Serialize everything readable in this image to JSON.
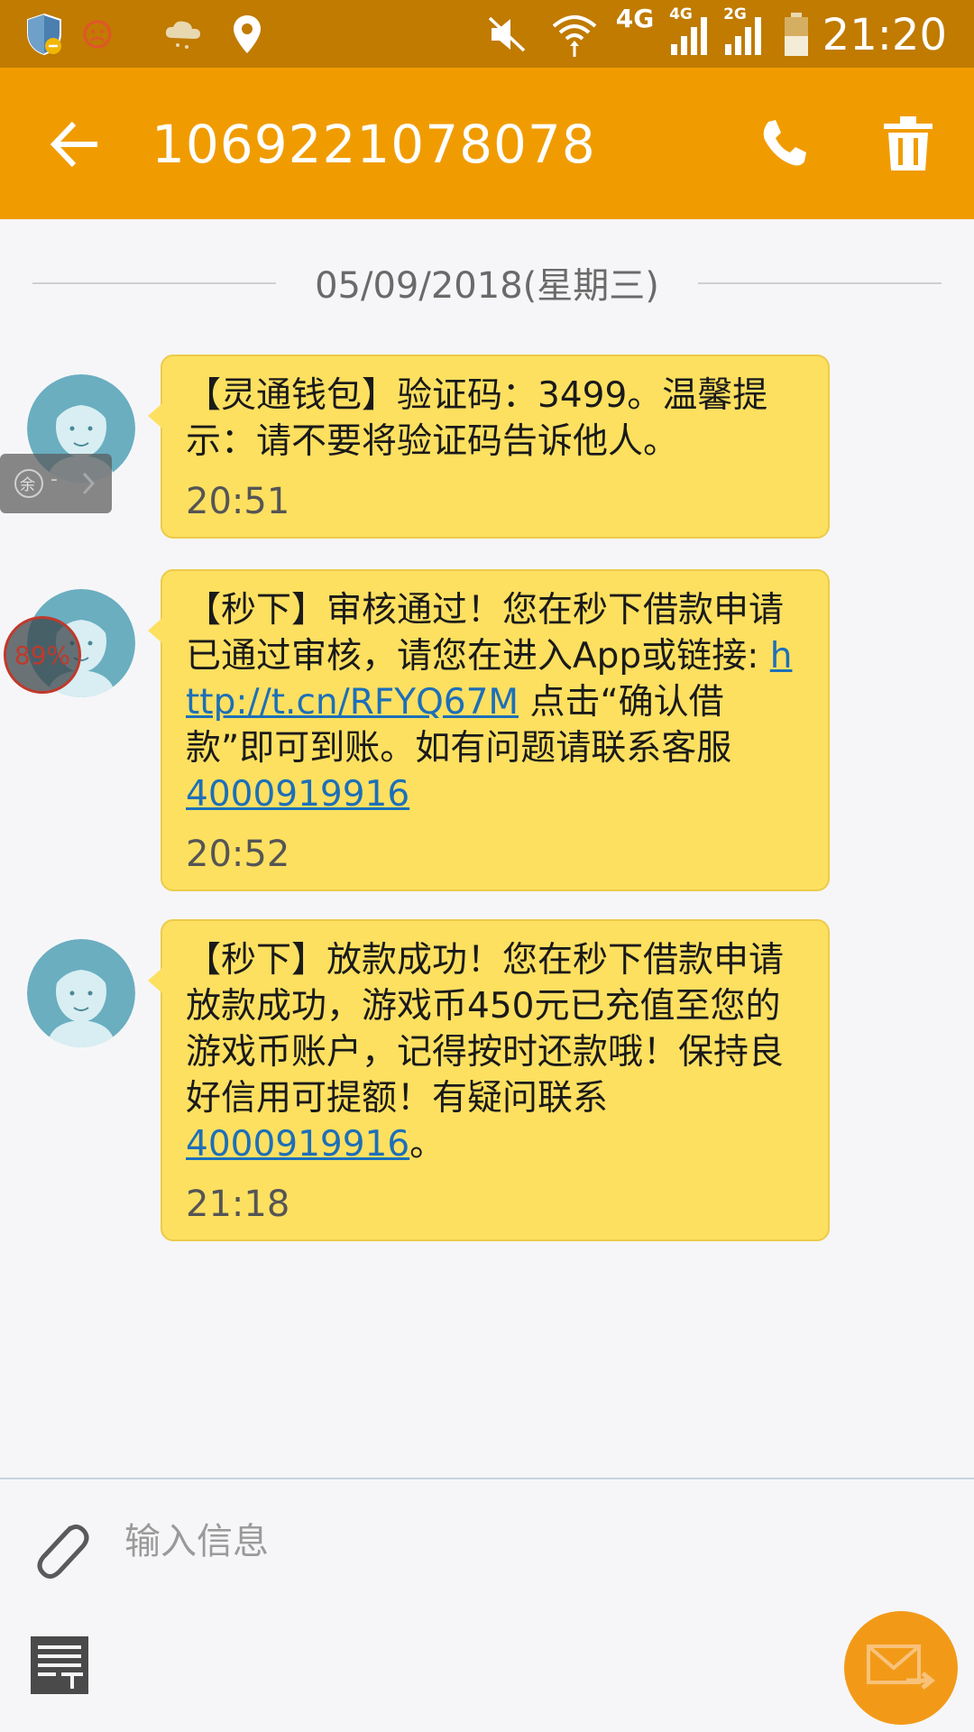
{
  "status_bar": {
    "network_4g": "4G",
    "sim1_label": "4G",
    "sim2_label": "2G",
    "time": "21:20"
  },
  "app_bar": {
    "contact": "1069221078078",
    "back_icon": "arrow-left-icon",
    "call_icon": "phone-icon",
    "delete_icon": "trash-icon"
  },
  "conversation": {
    "date": "05/09/2018(星期三)",
    "messages": [
      {
        "text": "【灵通钱包】验证码：3499。温馨提示：请不要将验证码告诉他人。",
        "time": "20:51"
      },
      {
        "text_before": "【秒下】审核通过！您在秒下借款申请已通过审核，请您在进入App或链接: ",
        "link": "http://t.cn/RFYQ67M",
        "text_middle": " 点击“确认借款”即可到账。如有问题请联系客服",
        "phone": "4000919916",
        "text_after": "",
        "time": "20:52"
      },
      {
        "text_before": "【秒下】放款成功！您在秒下借款申请放款成功，游戏币450元已充值至您的游戏币账户，记得按时还款哦！保持良好信用可提额！有疑问联系",
        "phone": "4000919916",
        "text_after": "。",
        "time": "21:18"
      }
    ]
  },
  "overlays": {
    "chip_label": "余",
    "chip_dash": "-",
    "badge_percent": "89%"
  },
  "compose": {
    "placeholder": "输入信息",
    "attach_icon": "paperclip-icon",
    "template_icon": "text-template-icon",
    "send_icon": "send-message-icon"
  },
  "colors": {
    "status_bar": "#c07b00",
    "app_bar": "#f09c00",
    "bubble": "#fde060",
    "link": "#1d6fb8",
    "send_button": "#f29a18"
  }
}
